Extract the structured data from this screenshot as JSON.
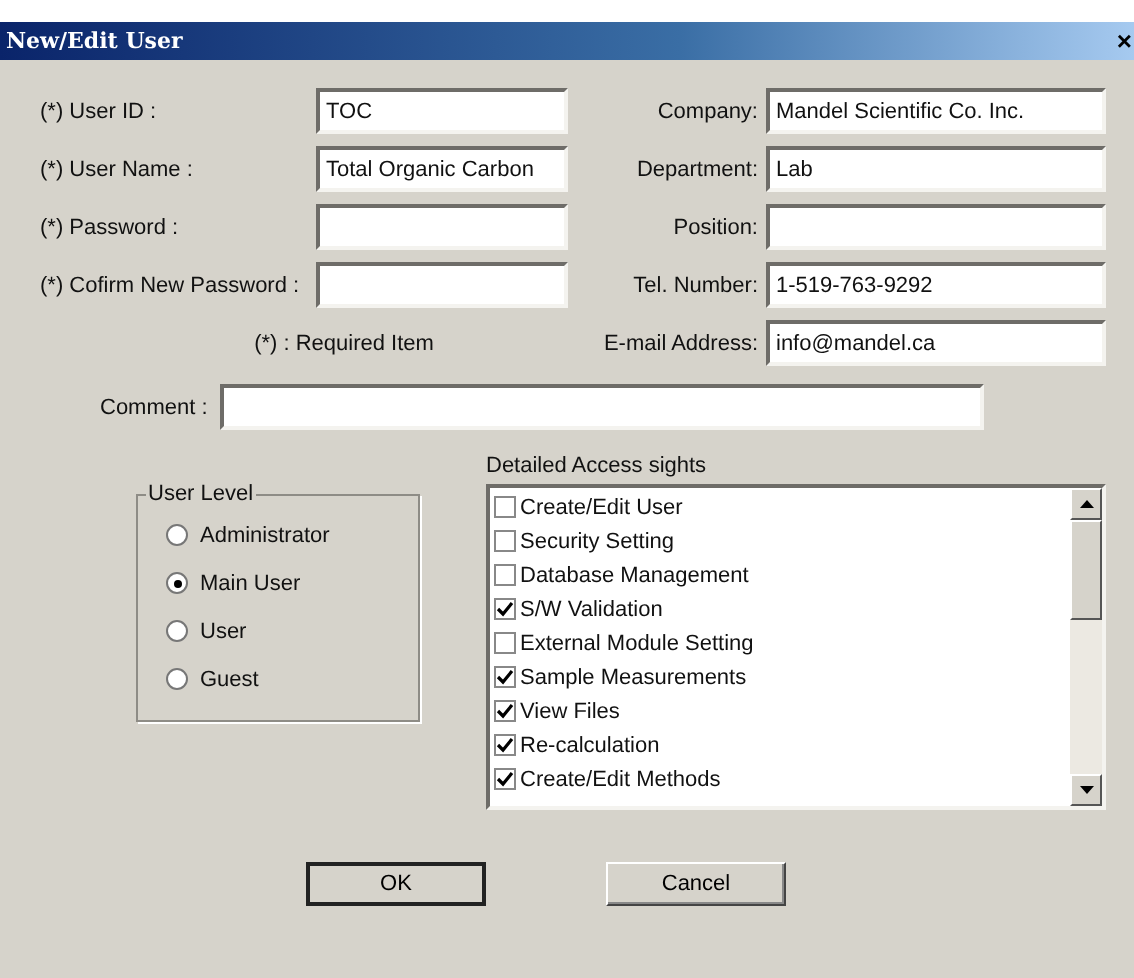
{
  "window": {
    "title": "New/Edit User",
    "close": "×"
  },
  "left_fields": [
    {
      "label": "(*) User ID :",
      "value": "TOC"
    },
    {
      "label": "(*) User Name :",
      "value": "Total Organic Carbon"
    },
    {
      "label": "(*) Password :"
    },
    {
      "label": "(*) Cofirm New Password :"
    }
  ],
  "right_fields": [
    {
      "label": "Company:",
      "value": "Mandel Scientific Co. Inc."
    },
    {
      "label": "Department:",
      "value": "Lab"
    },
    {
      "label": "Position:"
    },
    {
      "label": "Tel. Number:",
      "value": "1-519-763-9292"
    },
    {
      "label": "E-mail Address:",
      "value": "info@mandel.ca"
    }
  ],
  "required_note": "(*) : Required Item",
  "comment": {
    "label": "Comment :"
  },
  "user_level": {
    "title": "User Level",
    "options": [
      {
        "label": "Administrator",
        "selected": false
      },
      {
        "label": "Main User",
        "selected": true
      },
      {
        "label": "User",
        "selected": false
      },
      {
        "label": "Guest",
        "selected": false
      }
    ]
  },
  "access_rights": {
    "title": "Detailed Access sights",
    "items": [
      {
        "label": "Create/Edit User",
        "checked": false
      },
      {
        "label": "Security Setting",
        "checked": false
      },
      {
        "label": "Database Management",
        "checked": false
      },
      {
        "label": "S/W Validation",
        "checked": true
      },
      {
        "label": "External Module Setting",
        "checked": false
      },
      {
        "label": "Sample Measurements",
        "checked": true
      },
      {
        "label": "View Files",
        "checked": true
      },
      {
        "label": "Re-calculation",
        "checked": true
      },
      {
        "label": "Create/Edit Methods",
        "checked": true
      }
    ]
  },
  "buttons": [
    {
      "label": "OK",
      "default": true
    },
    {
      "label": "Cancel",
      "default": false
    }
  ]
}
